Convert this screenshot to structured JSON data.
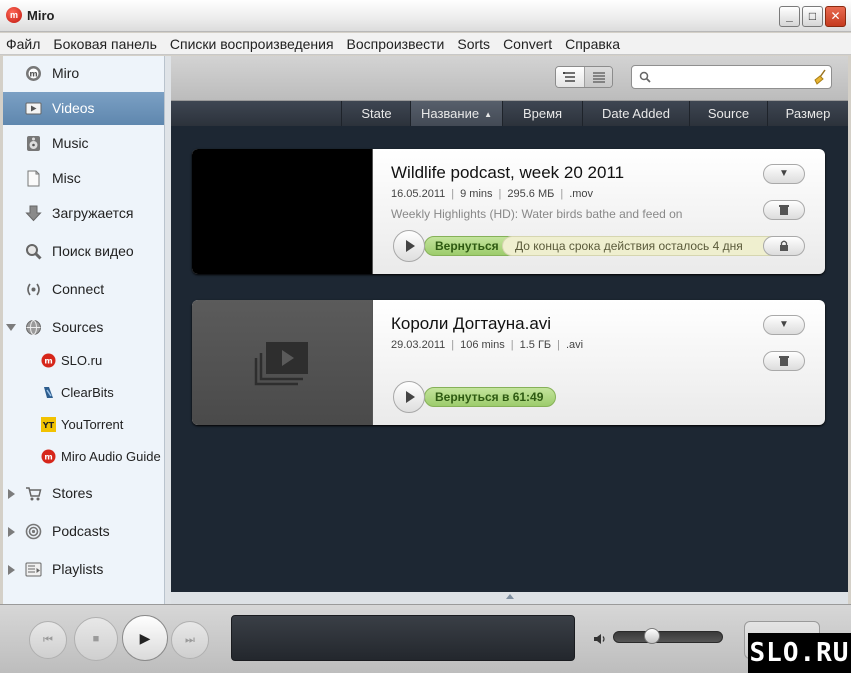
{
  "window": {
    "title": "Miro",
    "logo": "m"
  },
  "window_controls": {
    "minimize": "_",
    "maximize": "□",
    "close": "✕"
  },
  "menu": [
    "Файл",
    "Боковая панель",
    "Списки воспроизведения",
    "Воспроизвести",
    "Sorts",
    "Convert",
    "Справка"
  ],
  "sidebar": {
    "items": [
      {
        "label": "Miro",
        "icon": "miro-icon"
      },
      {
        "label": "Videos",
        "icon": "video-icon",
        "selected": true
      },
      {
        "label": "Music",
        "icon": "music-icon"
      },
      {
        "label": "Misc",
        "icon": "misc-icon"
      },
      {
        "label": "Загружается",
        "icon": "download-icon"
      },
      {
        "label": "Поиск видео",
        "icon": "magnifier-icon"
      },
      {
        "label": "Connect",
        "icon": "connect-icon"
      },
      {
        "label": "Sources",
        "icon": "globe-icon",
        "expanded": true
      },
      {
        "label": "SLO.ru",
        "icon": "miro-icon"
      },
      {
        "label": "ClearBits",
        "icon": "clearbits-icon"
      },
      {
        "label": "YouTorrent",
        "icon": "youtorrent-icon",
        "icon_text": "YT"
      },
      {
        "label": "Miro Audio Guide",
        "icon": "miro-icon"
      },
      {
        "label": "Stores",
        "icon": "cart-icon"
      },
      {
        "label": "Podcasts",
        "icon": "podcast-icon"
      },
      {
        "label": "Playlists",
        "icon": "playlist-icon"
      }
    ]
  },
  "toolbar": {
    "search_placeholder": ""
  },
  "columns": [
    "State",
    "Название",
    "Время",
    "Date Added",
    "Source",
    "Размер"
  ],
  "sorted_column": "Название",
  "videos": [
    {
      "title": "Wildlife podcast, week 20 2011",
      "date": "16.05.2011",
      "duration": "9 mins",
      "size": "295.6 МБ",
      "format": ".mov",
      "description": "Weekly Highlights (HD): Water birds bathe and feed on",
      "resume_label": "Вернуться в",
      "expiry_text": "До конца срока действия осталось 4 дня"
    },
    {
      "title": "Короли Догтауна.avi",
      "date": "29.03.2011",
      "duration": "106 mins",
      "size": "1.5 ГБ",
      "format": ".avi",
      "resume_label": "Вернуться в 61:49"
    }
  ],
  "watermark": "SLO.RU",
  "colors": {
    "selected": "#6b92b8",
    "resume_green": "#a9d479",
    "main_bg": "#1d2733"
  }
}
